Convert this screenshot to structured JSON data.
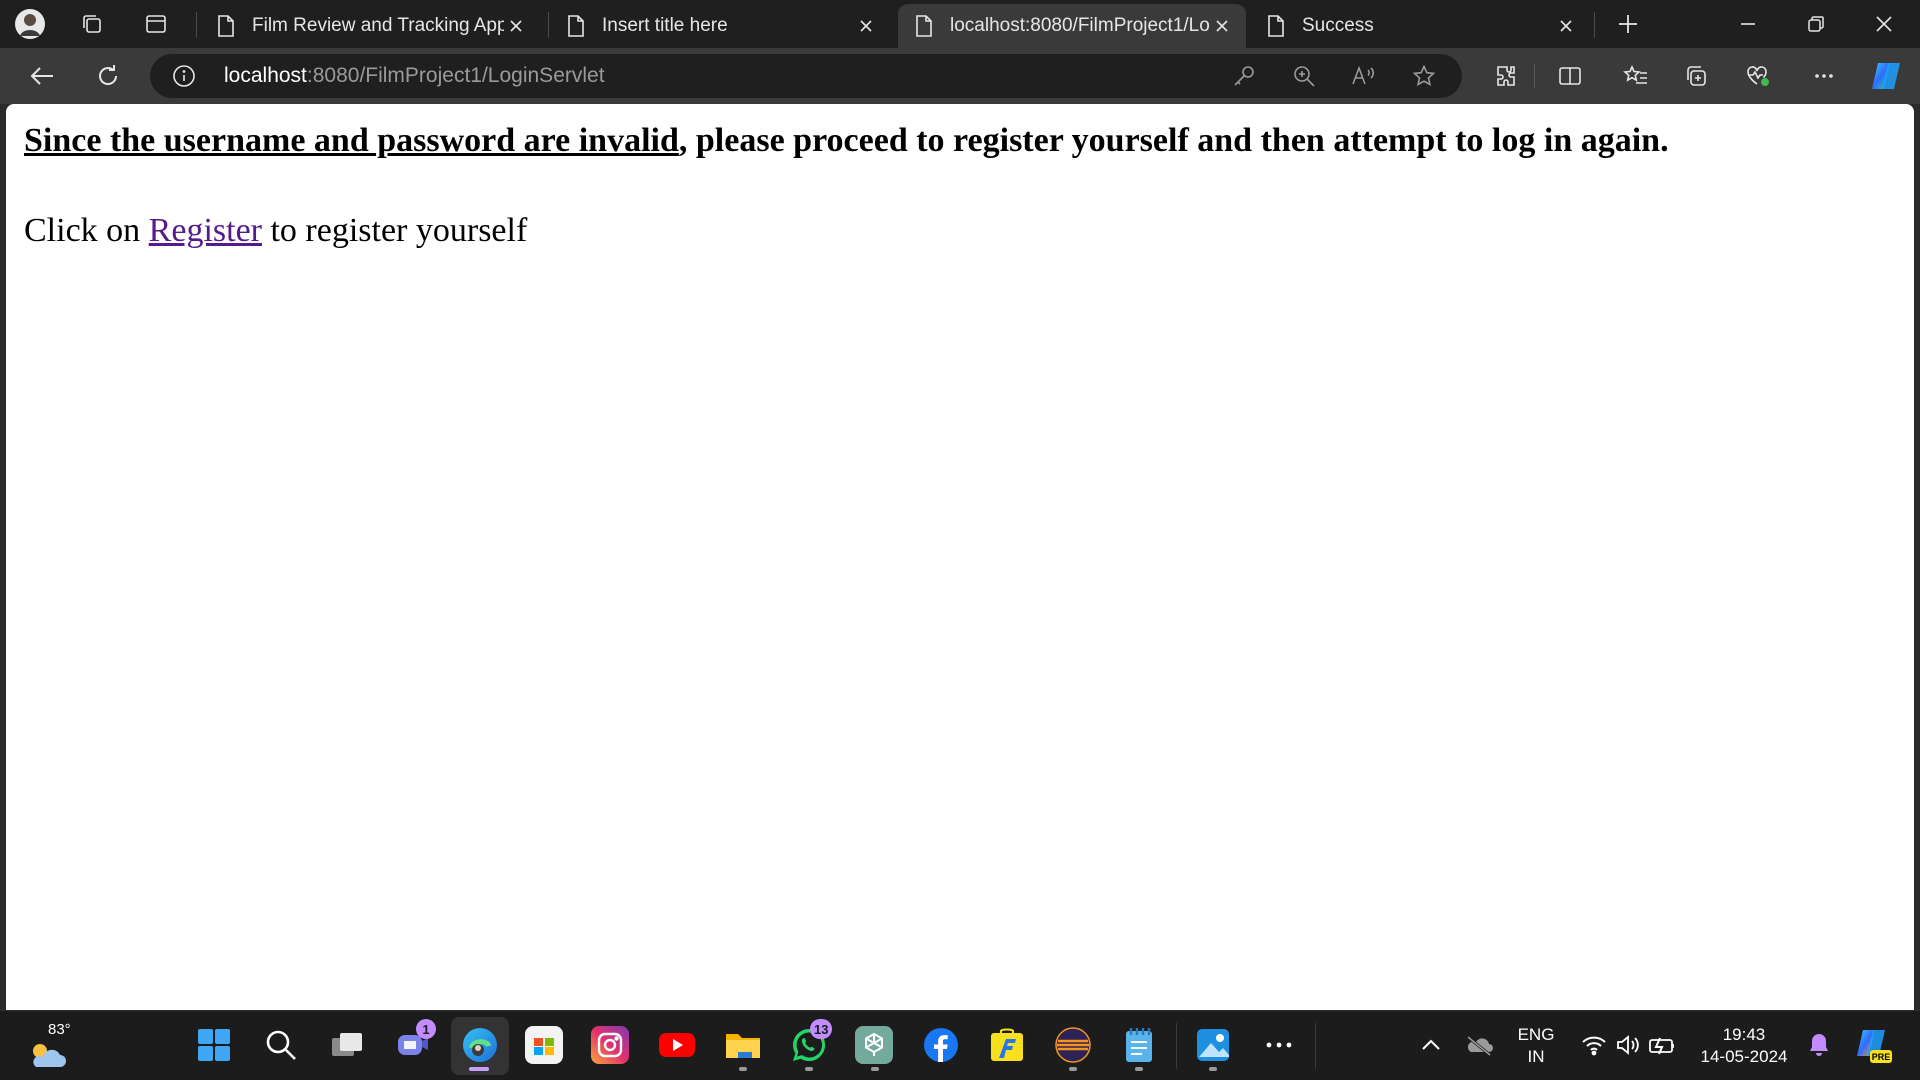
{
  "tabs": [
    {
      "title": "Film Review and Tracking App",
      "active": false
    },
    {
      "title": "Insert title here",
      "active": false
    },
    {
      "title": "localhost:8080/FilmProject1/Log",
      "active": true
    },
    {
      "title": "Success",
      "active": false
    }
  ],
  "address_bar": {
    "host": "localhost",
    "rest": ":8080/FilmProject1/LoginServlet"
  },
  "page": {
    "heading_underlined": "Since the username and password are invalid",
    "heading_rest": ", please proceed to register yourself and then attempt to log in again.",
    "body_prefix": "Click on ",
    "register_link": "Register",
    "body_suffix": " to register yourself"
  },
  "taskbar": {
    "weather_temp": "83°",
    "teams_badge": "1",
    "whatsapp_badge": "13",
    "language_line1": "ENG",
    "language_line2": "IN",
    "time": "19:43",
    "date": "14-05-2024",
    "copilot_label": "PRE"
  },
  "colors": {
    "link": "#551a8b",
    "accent": "#c28cff"
  }
}
